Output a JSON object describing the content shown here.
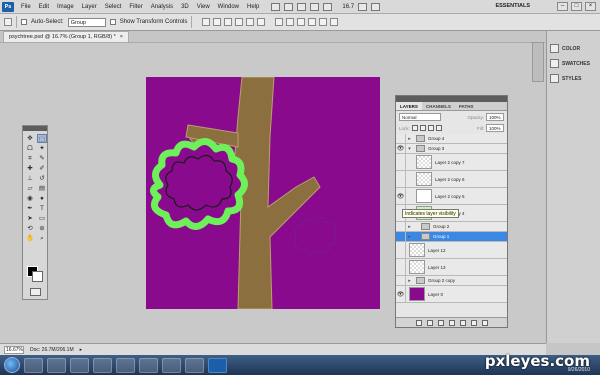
{
  "menubar": {
    "logo": "Ps",
    "items": [
      "File",
      "Edit",
      "Image",
      "Layer",
      "Select",
      "Filter",
      "Analysis",
      "3D",
      "View",
      "Window",
      "Help"
    ],
    "zoom": "16.7",
    "workspace": "ESSENTIALS"
  },
  "options": {
    "auto_select_label": "Auto-Select:",
    "auto_select_value": "Group",
    "show_transform_label": "Show Transform Controls"
  },
  "document": {
    "tab_title": "psychtree.psd @ 16.7% (Group 1, RGB/8) *",
    "close": "×"
  },
  "panels": {
    "dock": [
      "COLOR",
      "SWATCHES",
      "STYLES"
    ],
    "layers": {
      "tabs": [
        "LAYERS",
        "CHANNELS",
        "PATHS"
      ],
      "blend_mode": "Normal",
      "opacity_label": "Opacity:",
      "opacity": "100%",
      "lock_label": "Lock:",
      "fill_label": "Fill:",
      "fill": "100%",
      "rows": [
        {
          "name": "Group 4"
        },
        {
          "name": "Group 3"
        },
        {
          "name": "Layer 2 copy 7"
        },
        {
          "name": "Layer 2 copy 6"
        },
        {
          "name": "Layer 2 copy 5"
        },
        {
          "name": "Layer 2 copy 4"
        },
        {
          "name": "Group 2"
        },
        {
          "name": "Group 1"
        },
        {
          "name": "Layer 12"
        },
        {
          "name": "Layer 13"
        },
        {
          "name": "Group 2 copy"
        },
        {
          "name": "Layer 0"
        }
      ]
    }
  },
  "tooltip": "Indicates layer visibility",
  "status": {
    "zoom": "16.67%",
    "doc": "Doc: 26.7M/206.1M"
  },
  "colors": {
    "canvas_bg": "#8a0a8e",
    "trunk": "#8b6f3e",
    "foliage_outline": "#6ef05a",
    "selection": "#3a88e3"
  },
  "watermark": "pxleyes.com",
  "tray_date": "9/26/2010"
}
